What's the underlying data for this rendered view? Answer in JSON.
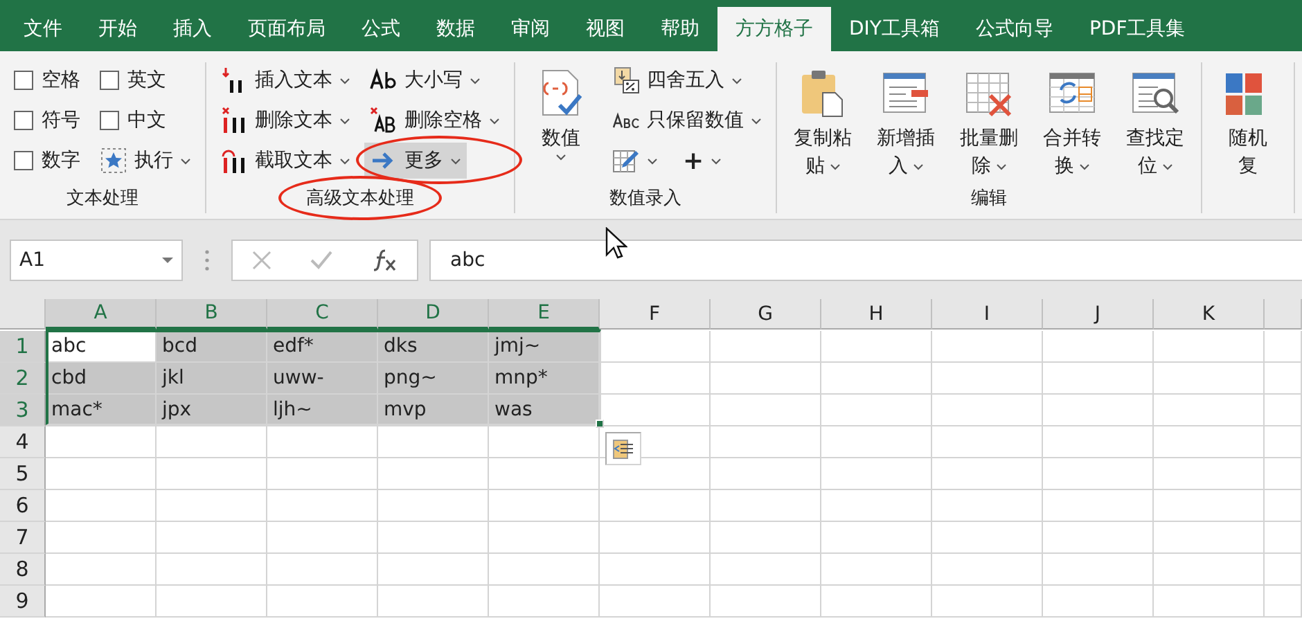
{
  "tabs": [
    {
      "label": "文件",
      "selected": false
    },
    {
      "label": "开始",
      "selected": false
    },
    {
      "label": "插入",
      "selected": false
    },
    {
      "label": "页面布局",
      "selected": false
    },
    {
      "label": "公式",
      "selected": false
    },
    {
      "label": "数据",
      "selected": false
    },
    {
      "label": "审阅",
      "selected": false
    },
    {
      "label": "视图",
      "selected": false
    },
    {
      "label": "帮助",
      "selected": false
    },
    {
      "label": "方方格子",
      "selected": true
    },
    {
      "label": "DIY工具箱",
      "selected": false
    },
    {
      "label": "公式向导",
      "selected": false
    },
    {
      "label": "PDF工具集",
      "selected": false
    }
  ],
  "ribbon": {
    "groups": [
      {
        "label": "文本处理",
        "circled": false,
        "items": [
          {
            "kind": "checkbox",
            "label": "空格",
            "checked": false
          },
          {
            "kind": "checkbox",
            "label": "符号",
            "checked": false
          },
          {
            "kind": "checkbox",
            "label": "数字",
            "checked": false
          },
          {
            "kind": "checkbox",
            "label": "英文",
            "checked": false
          },
          {
            "kind": "checkbox",
            "label": "中文",
            "checked": false
          },
          {
            "kind": "small",
            "label": "执行",
            "dropdown": true,
            "highlighted": false,
            "circled": false
          }
        ]
      },
      {
        "label": "高级文本处理",
        "circled": true,
        "items": [
          {
            "kind": "small",
            "label": "插入文本",
            "dropdown": true,
            "highlighted": false,
            "circled": false
          },
          {
            "kind": "small",
            "label": "删除文本",
            "dropdown": true,
            "highlighted": false,
            "circled": false
          },
          {
            "kind": "small",
            "label": "截取文本",
            "dropdown": true,
            "highlighted": false,
            "circled": false
          },
          {
            "kind": "small",
            "label": "大小写",
            "dropdown": true,
            "highlighted": false,
            "circled": false
          },
          {
            "kind": "small",
            "label": "删除空格",
            "dropdown": true,
            "highlighted": false,
            "circled": false
          },
          {
            "kind": "small",
            "label": "更多",
            "dropdown": true,
            "highlighted": true,
            "circled": true
          }
        ]
      },
      {
        "label": "数值录入",
        "circled": false,
        "items": [
          {
            "kind": "large",
            "lines": [
              "数值"
            ],
            "dropdown": true
          },
          {
            "kind": "small",
            "label": "四舍五入",
            "dropdown": true,
            "highlighted": false,
            "circled": false
          },
          {
            "kind": "small",
            "label": "只保留数值",
            "dropdown": true,
            "highlighted": false,
            "circled": false
          },
          {
            "kind": "row",
            "items": [
              {
                "kind": "small",
                "dropdown": true,
                "highlighted": false,
                "circled": false
              },
              {
                "kind": "small",
                "label": "+",
                "dropdown": true,
                "highlighted": false,
                "circled": false
              }
            ]
          }
        ]
      },
      {
        "label": "编辑",
        "circled": false,
        "items": [
          {
            "kind": "large",
            "lines": [
              "复制粘",
              "贴"
            ],
            "dropdown": true
          },
          {
            "kind": "large",
            "lines": [
              "新增插",
              "入"
            ],
            "dropdown": true
          },
          {
            "kind": "large",
            "lines": [
              "批量删",
              "除"
            ],
            "dropdown": true
          },
          {
            "kind": "large",
            "lines": [
              "合并转",
              "换"
            ],
            "dropdown": true
          },
          {
            "kind": "large",
            "lines": [
              "查找定",
              "位"
            ],
            "dropdown": true
          }
        ]
      },
      {
        "items": [
          {
            "kind": "large",
            "lines": [
              "随机",
              "复"
            ],
            "dropdown": false
          }
        ]
      }
    ]
  },
  "formula_bar": {
    "name_box": "A1",
    "formula": "abc"
  },
  "sheet": {
    "columns": [
      {
        "label": "A",
        "selected": true
      },
      {
        "label": "B",
        "selected": true
      },
      {
        "label": "C",
        "selected": true
      },
      {
        "label": "D",
        "selected": true
      },
      {
        "label": "E",
        "selected": true
      },
      {
        "label": "F",
        "selected": false
      },
      {
        "label": "G",
        "selected": false
      },
      {
        "label": "H",
        "selected": false
      },
      {
        "label": "I",
        "selected": false
      },
      {
        "label": "J",
        "selected": false
      },
      {
        "label": "K",
        "selected": false
      }
    ],
    "rows": [
      {
        "label": "1",
        "selected": true,
        "cells": [
          {
            "text": "abc",
            "selected": false
          },
          {
            "text": "bcd",
            "selected": true
          },
          {
            "text": "edf*",
            "selected": true
          },
          {
            "text": "dks",
            "selected": true
          },
          {
            "text": "jmj~",
            "selected": true
          }
        ]
      },
      {
        "label": "2",
        "selected": true,
        "cells": [
          {
            "text": "cbd",
            "selected": true
          },
          {
            "text": "jkl",
            "selected": true
          },
          {
            "text": "uww-",
            "selected": true
          },
          {
            "text": "png~",
            "selected": true
          },
          {
            "text": "mnp*",
            "selected": true
          }
        ]
      },
      {
        "label": "3",
        "selected": true,
        "cells": [
          {
            "text": "mac*",
            "selected": true
          },
          {
            "text": "jpx",
            "selected": true
          },
          {
            "text": "ljh~",
            "selected": true
          },
          {
            "text": "mvp",
            "selected": true
          },
          {
            "text": "was",
            "selected": true
          }
        ]
      },
      {
        "label": "4",
        "selected": false,
        "cells": []
      },
      {
        "label": "5",
        "selected": false,
        "cells": []
      },
      {
        "label": "6",
        "selected": false,
        "cells": []
      },
      {
        "label": "7",
        "selected": false,
        "cells": []
      },
      {
        "label": "8",
        "selected": false,
        "cells": []
      },
      {
        "label": "9",
        "selected": false,
        "cells": []
      }
    ]
  }
}
